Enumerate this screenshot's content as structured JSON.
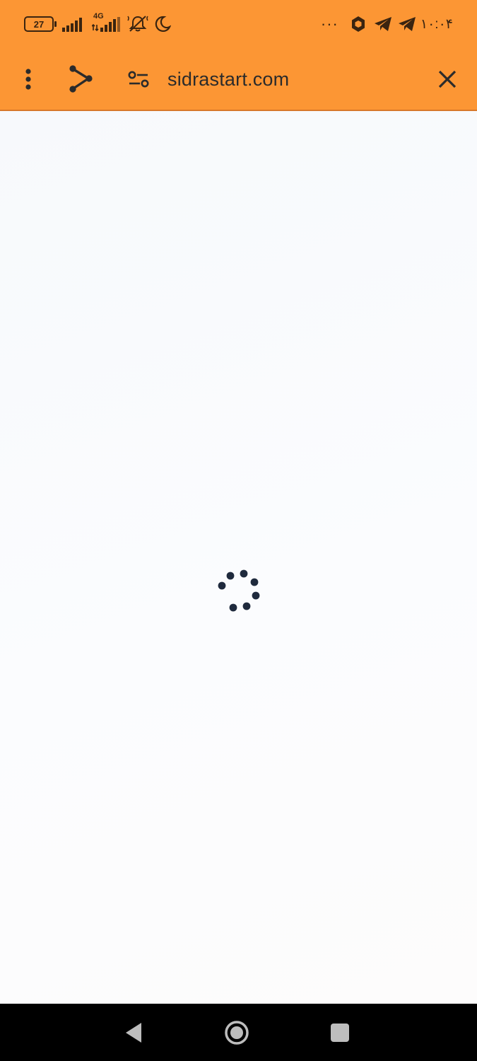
{
  "status_bar": {
    "battery_level": "27",
    "network_label": "4G",
    "more_indicator": "···",
    "time": "۱۰:۰۴",
    "icons": [
      "battery-icon",
      "signal-icon",
      "signal-4g-icon",
      "mute-icon",
      "do-not-disturb-icon",
      "notification-dots-icon",
      "app-notification-icon",
      "telegram-icon",
      "telegram-icon"
    ]
  },
  "toolbar": {
    "url": "sidrastart.com",
    "icons": [
      "more-vert-icon",
      "share-icon",
      "site-settings-icon",
      "close-icon"
    ]
  },
  "content": {
    "state": "loading",
    "spinner_color": "#1f2a3d"
  },
  "nav_bar": {
    "icons": [
      "back-icon",
      "home-icon",
      "recents-icon"
    ]
  },
  "colors": {
    "accent": "#FC9634",
    "nav_background": "#000000"
  }
}
